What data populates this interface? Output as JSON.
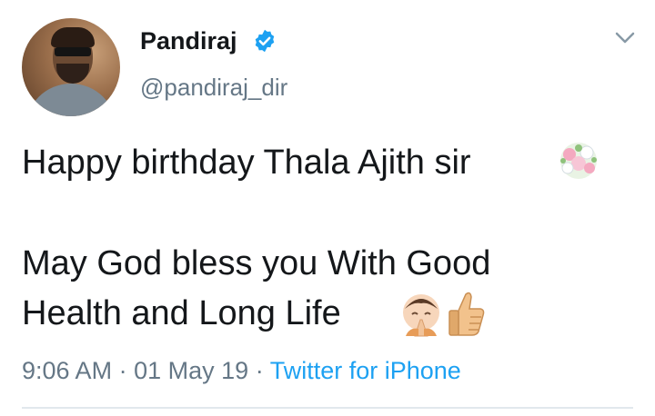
{
  "tweet": {
    "author": {
      "name": "Pandiraj",
      "handle": "@pandiraj_dir",
      "verified": true
    },
    "text_lines": [
      "Happy birthday Thala Ajith sir",
      "May God bless you With Good",
      "Health and Long Life"
    ],
    "emojis": [
      "bouquet-icon",
      "folded-hands-icon",
      "thumbs-up-icon"
    ],
    "time": "9:06 AM",
    "date": "01 May 19",
    "separator": "·",
    "source": "Twitter for iPhone"
  },
  "colors": {
    "text": "#14171a",
    "secondary": "#657786",
    "link": "#1da1f2",
    "divider": "#e1e8ed"
  }
}
